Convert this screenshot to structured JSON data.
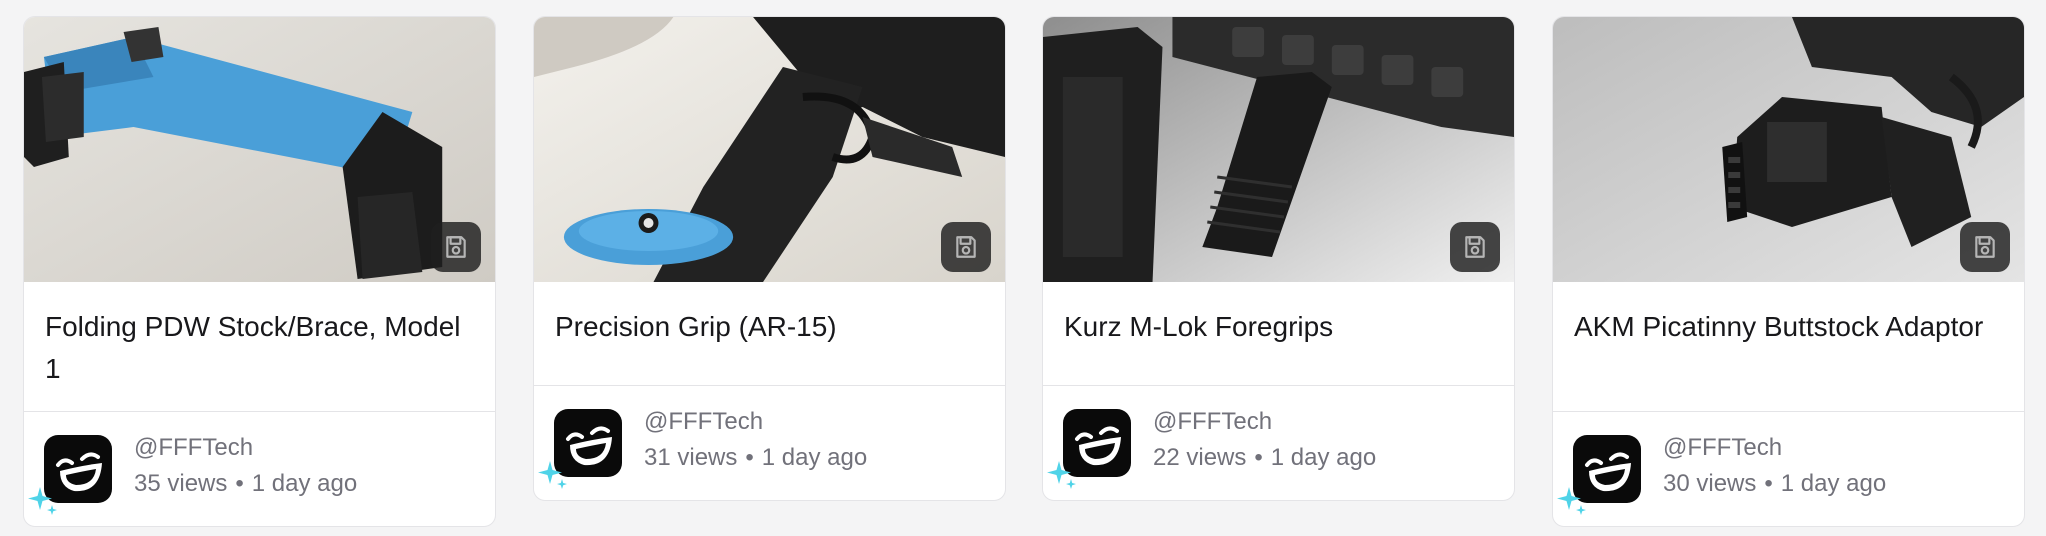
{
  "cards": [
    {
      "title": "Folding PDW Stock/Brace, Model 1",
      "author": "@FFFTech",
      "views": "35 views",
      "age": "1 day ago"
    },
    {
      "title": "Precision Grip (AR-15)",
      "author": "@FFFTech",
      "views": "31 views",
      "age": "1 day ago"
    },
    {
      "title": "Kurz M-Lok Foregrips",
      "author": "@FFFTech",
      "views": "22 views",
      "age": "1 day ago"
    },
    {
      "title": "AKM Picatinny Buttstock Adaptor",
      "author": "@FFFTech",
      "views": "30 views",
      "age": "1 day ago"
    }
  ],
  "separator": "•",
  "icons": {
    "save": "floppy-disk-icon",
    "avatar": "laughing-face-avatar",
    "badge": "sparkle-icon"
  },
  "colors": {
    "accent_blue": "#4a9fd8",
    "sparkle": "#4fd3e8",
    "text_primary": "#18181b",
    "text_secondary": "#71717a"
  }
}
